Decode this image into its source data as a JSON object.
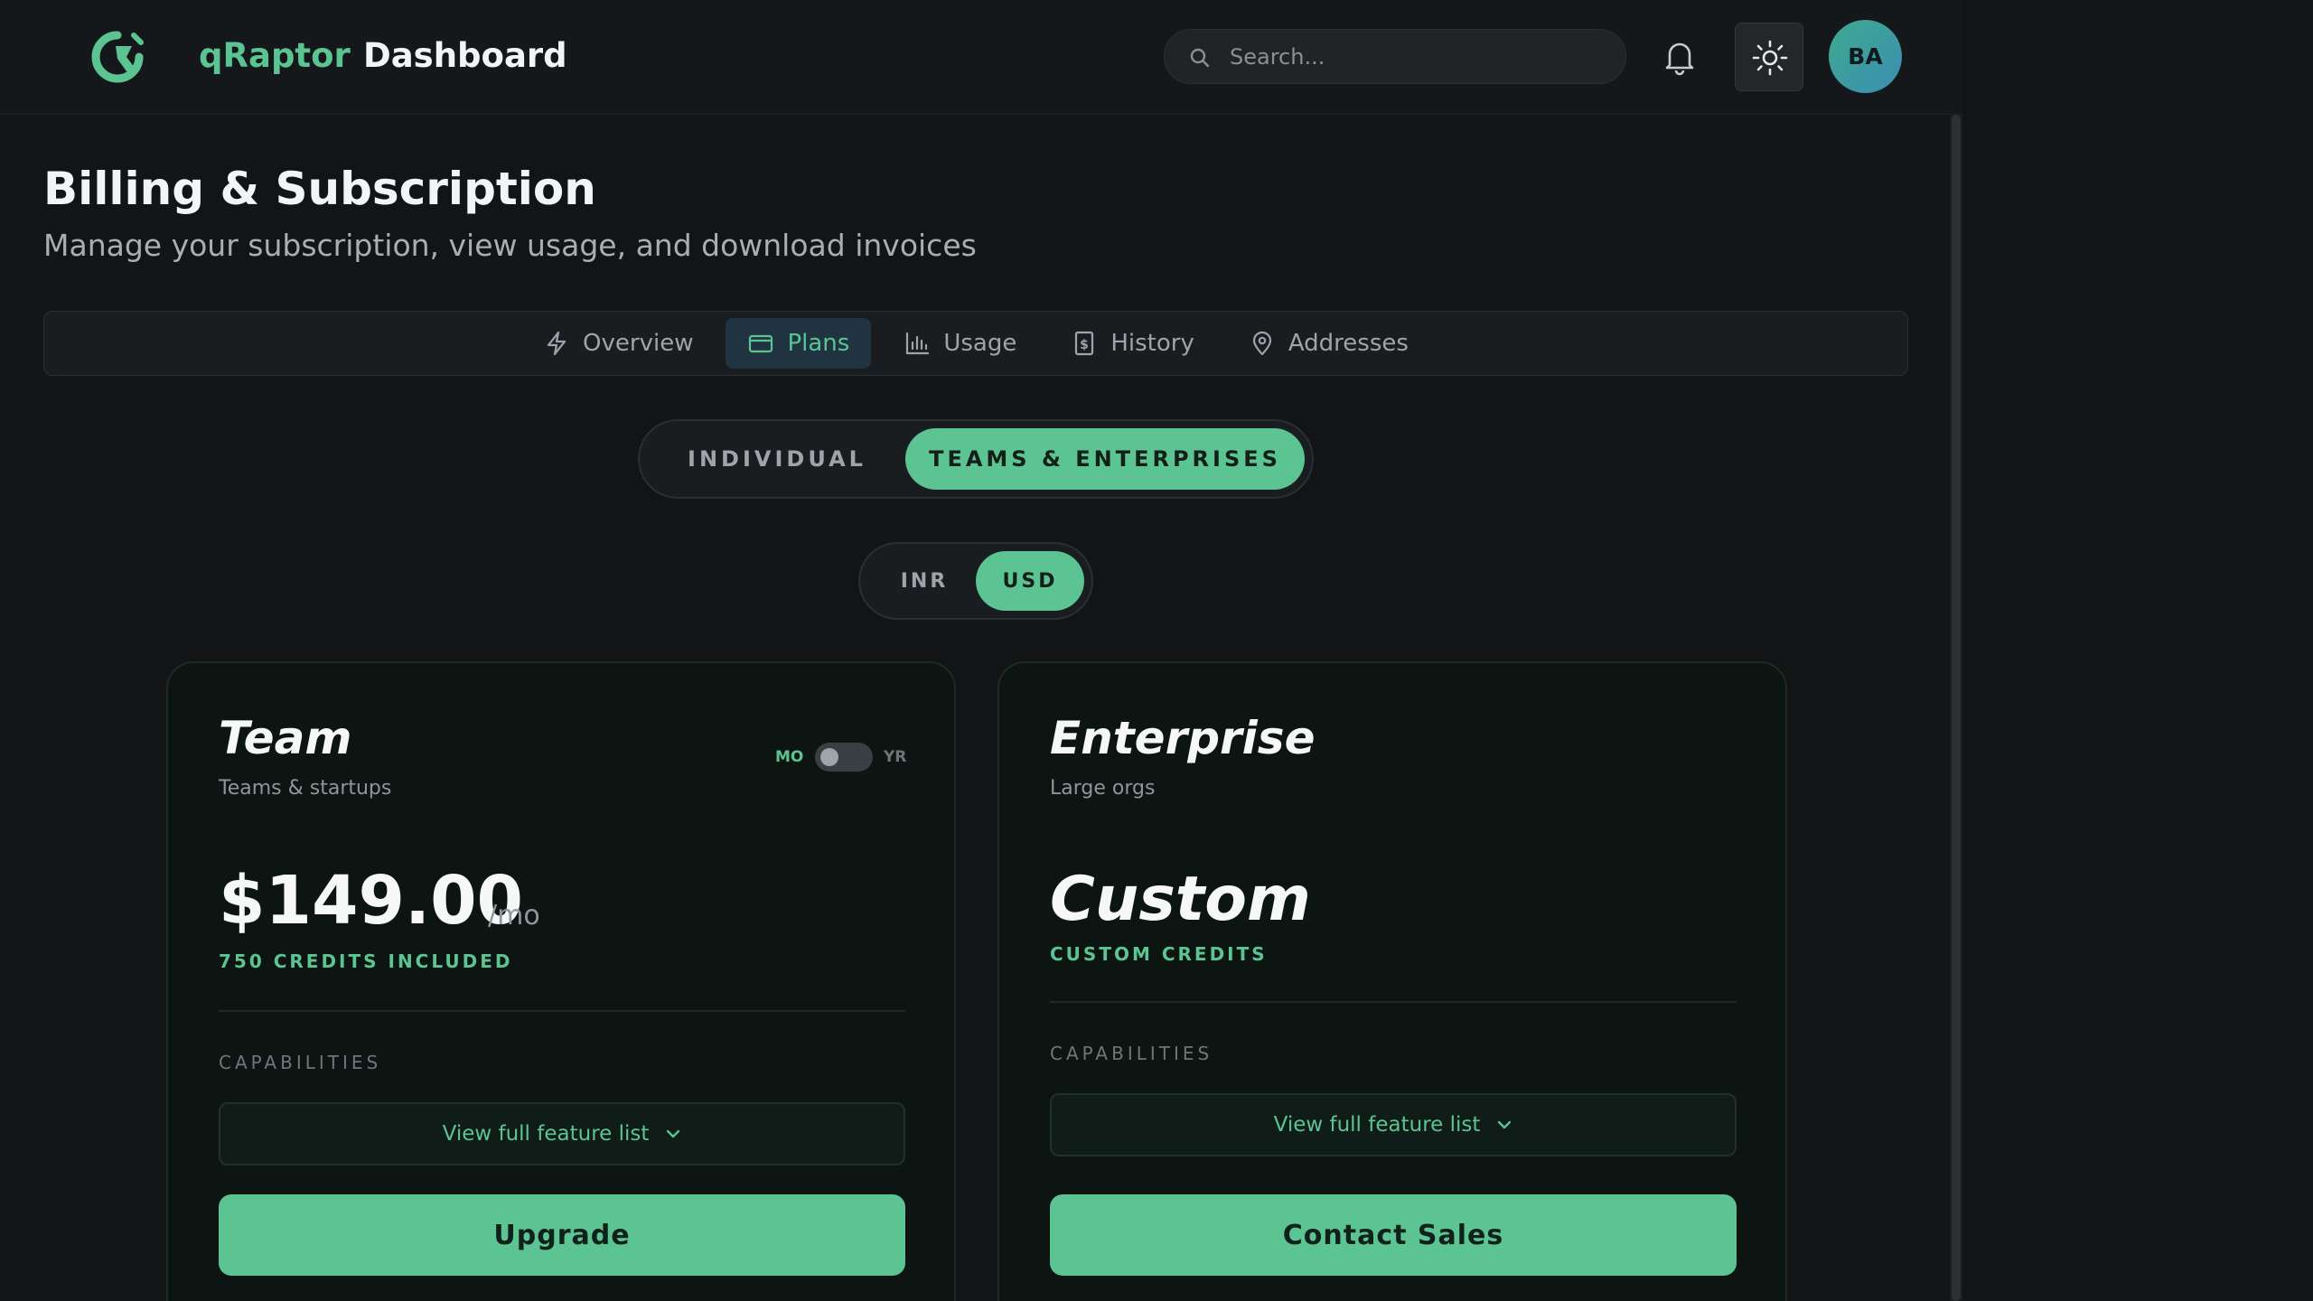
{
  "header": {
    "brand": "qRaptor",
    "title": "Dashboard",
    "search_placeholder": "Search...",
    "avatar_initials": "BA",
    "icons": [
      "logo",
      "search-icon",
      "bell-icon",
      "sun-icon"
    ]
  },
  "page": {
    "title": "Billing & Subscription",
    "subtitle": "Manage your subscription, view usage, and download invoices"
  },
  "tabs": [
    {
      "label": "Overview",
      "icon": "lightning-icon",
      "active": false
    },
    {
      "label": "Plans",
      "icon": "credit-card-icon",
      "active": true
    },
    {
      "label": "Usage",
      "icon": "bar-chart-icon",
      "active": false
    },
    {
      "label": "History",
      "icon": "receipt-icon",
      "active": false
    },
    {
      "label": "Addresses",
      "icon": "map-pin-icon",
      "active": false
    }
  ],
  "audience_toggle": {
    "options": [
      "INDIVIDUAL",
      "TEAMS & ENTERPRISES"
    ],
    "selected": "TEAMS & ENTERPRISES"
  },
  "currency_toggle": {
    "options": [
      "INR",
      "USD"
    ],
    "selected": "USD"
  },
  "plans": [
    {
      "name": "Team",
      "tagline": "Teams & startups",
      "billing_toggle": {
        "left": "MO",
        "right": "YR",
        "selected": "MO"
      },
      "price": "$149.00",
      "period": "/mo",
      "credits": "750 CREDITS INCLUDED",
      "capabilities_label": "CAPABILITIES",
      "feature_list_label": "View full feature list",
      "cta_label": "Upgrade"
    },
    {
      "name": "Enterprise",
      "tagline": "Large orgs",
      "price": "Custom",
      "credits": "CUSTOM CREDITS",
      "capabilities_label": "CAPABILITIES",
      "feature_list_label": "View full feature list",
      "cta_label": "Contact Sales"
    }
  ],
  "colors": {
    "accent": "#5bc492",
    "background": "#121416",
    "card_background": "#0d1513"
  }
}
